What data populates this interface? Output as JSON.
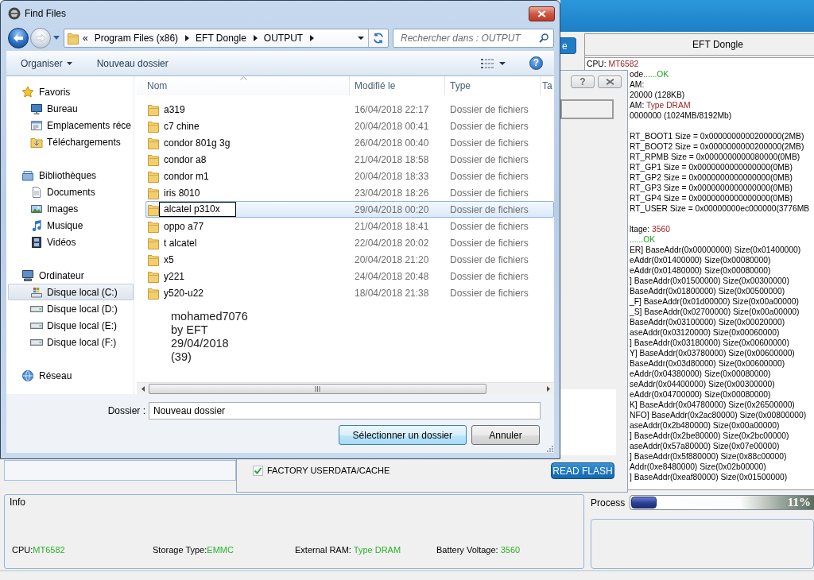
{
  "find_files_dialog": {
    "title": "Find Files",
    "address_bar": {
      "overflow": "«",
      "crumbs": [
        "Program Files (x86)",
        "EFT Dongle",
        "OUTPUT"
      ]
    },
    "search": {
      "placeholder": "Rechercher dans : OUTPUT"
    },
    "toolbar": {
      "organise": "Organiser",
      "new_folder": "Nouveau dossier",
      "help": "?"
    },
    "navigation": [
      {
        "label": "Favoris",
        "selected": false,
        "children": [
          {
            "label": "Bureau",
            "selected": false
          },
          {
            "label": "Emplacements réce",
            "selected": false
          },
          {
            "label": "Téléchargements",
            "selected": false
          }
        ]
      },
      {
        "label": "Bibliothèques",
        "selected": false,
        "children": [
          {
            "label": "Documents",
            "selected": false
          },
          {
            "label": "Images",
            "selected": false
          },
          {
            "label": "Musique",
            "selected": false
          },
          {
            "label": "Vidéos",
            "selected": false
          }
        ]
      },
      {
        "label": "Ordinateur",
        "selected": false,
        "children": [
          {
            "label": "Disque local (C:)",
            "selected": true
          },
          {
            "label": "Disque local (D:)",
            "selected": false
          },
          {
            "label": "Disque local (E:)",
            "selected": false
          },
          {
            "label": "Disque local (F:)",
            "selected": false
          }
        ]
      },
      {
        "label": "Réseau",
        "selected": false
      }
    ],
    "list": {
      "columns": [
        {
          "label": "Nom",
          "sorted": true
        },
        {
          "label": "Modifié le",
          "sorted": false
        },
        {
          "label": "Type",
          "sorted": false
        },
        {
          "label": "Ta",
          "sorted": false
        }
      ],
      "rows": [
        {
          "name": "a319",
          "modified": "16/04/2018 22:17",
          "type": "Dossier de fichiers",
          "selected": false,
          "editing": false
        },
        {
          "name": "c7 chine",
          "modified": "20/04/2018 00:41",
          "type": "Dossier de fichiers",
          "selected": false,
          "editing": false
        },
        {
          "name": "condor 801g 3g",
          "modified": "26/04/2018 00:40",
          "type": "Dossier de fichiers",
          "selected": false,
          "editing": false
        },
        {
          "name": "condor a8",
          "modified": "21/04/2018 18:58",
          "type": "Dossier de fichiers",
          "selected": false,
          "editing": false
        },
        {
          "name": "condor m1",
          "modified": "20/04/2018 18:33",
          "type": "Dossier de fichiers",
          "selected": false,
          "editing": false
        },
        {
          "name": "iris 8010",
          "modified": "23/04/2018 18:26",
          "type": "Dossier de fichiers",
          "selected": false,
          "editing": false
        },
        {
          "name": "alcatel p310x",
          "modified": "29/04/2018 00:20",
          "type": "Dossier de fichiers",
          "selected": true,
          "editing": true
        },
        {
          "name": "oppo a77",
          "modified": "21/04/2018 18:41",
          "type": "Dossier de fichiers",
          "selected": false,
          "editing": false
        },
        {
          "name": "t alcatel",
          "modified": "22/04/2018 20:02",
          "type": "Dossier de fichiers",
          "selected": false,
          "editing": false
        },
        {
          "name": "x5",
          "modified": "20/04/2018 21:20",
          "type": "Dossier de fichiers",
          "selected": false,
          "editing": false
        },
        {
          "name": "y221",
          "modified": "24/04/2018 20:48",
          "type": "Dossier de fichiers",
          "selected": false,
          "editing": false
        },
        {
          "name": "y520-u22",
          "modified": "18/04/2018 21:38",
          "type": "Dossier de fichiers",
          "selected": false,
          "editing": false
        }
      ]
    },
    "signature": [
      "mohamed7076",
      "by EFT",
      "29/04/2018",
      "(39)"
    ],
    "folder_field": {
      "label": "Dossier :",
      "value": "Nouveau dossier"
    },
    "buttons": [
      {
        "label": "Sélectionner un dossier",
        "default": true
      },
      {
        "label": "Annuler",
        "default": false
      }
    ]
  },
  "flash_dialog": {
    "help": "?",
    "options": [
      {
        "label": "FACTORY USERDATA/CACHE",
        "checked": true
      }
    ],
    "read_button": "READ FLASH"
  },
  "app_window": {
    "top_button": {
      "label": "e"
    },
    "log_panel": {
      "title": "EFT Dongle",
      "blocks": [
        [
          {
            "text": "CPU: ",
            "value": "MT6582",
            "kind": "value"
          },
          {
            "text": "ode",
            "value": "......OK",
            "kind": "status"
          },
          {
            "text": "AM:"
          },
          {
            "text": "20000 (128KB)"
          },
          {
            "text": "AM: ",
            "value": "Type DRAM",
            "kind": "value"
          },
          {
            "text": "0000000 (1024MB/8192Mb)"
          }
        ],
        [
          {
            "text": "RT_BOOT1 Size = 0x0000000000200000(2MB)"
          },
          {
            "text": "RT_BOOT2 Size = 0x0000000000200000(2MB)"
          },
          {
            "text": "RT_RPMB Size = 0x0000000000080000(0MB)"
          },
          {
            "text": "RT_GP1 Size = 0x0000000000000000(0MB)"
          },
          {
            "text": "RT_GP2 Size = 0x0000000000000000(0MB)"
          },
          {
            "text": "RT_GP3 Size = 0x0000000000000000(0MB)"
          },
          {
            "text": "RT_GP4 Size = 0x0000000000000000(0MB)"
          },
          {
            "text": "RT_USER Size = 0x00000000ec000000(3776MB"
          }
        ],
        [
          {
            "text": "ltage: ",
            "value": "3560",
            "kind": "value"
          },
          {
            "value": "......OK",
            "kind": "status"
          },
          {
            "text": "ER] BaseAddr(0x00000000) Size(0x01400000)"
          },
          {
            "text": "eAddr(0x01400000) Size(0x00080000)"
          },
          {
            "text": "eAddr(0x01480000) Size(0x00080000)"
          },
          {
            "text": "] BaseAddr(0x01500000) Size(0x00300000)"
          },
          {
            "text": "BaseAddr(0x01800000) Size(0x00500000)"
          },
          {
            "text": "_F] BaseAddr(0x01d00000) Size(0x00a00000)"
          },
          {
            "text": "_S] BaseAddr(0x02700000) Size(0x00a00000)"
          },
          {
            "text": "BaseAddr(0x03100000) Size(0x00020000)"
          },
          {
            "text": "aseAddr(0x03120000) Size(0x00060000)"
          },
          {
            "text": "] BaseAddr(0x03180000) Size(0x00600000)"
          },
          {
            "text": "Y] BaseAddr(0x03780000) Size(0x00600000)"
          },
          {
            "text": "BaseAddr(0x03d80000) Size(0x00600000)"
          },
          {
            "text": "eAddr(0x04380000) Size(0x00080000)"
          },
          {
            "text": "seAddr(0x04400000) Size(0x00300000)"
          },
          {
            "text": "eAddr(0x04700000) Size(0x00080000)"
          },
          {
            "text": "K] BaseAddr(0x04780000) Size(0x26500000)"
          },
          {
            "text": "NFO] BaseAddr(0x2ac80000) Size(0x00800000)"
          },
          {
            "text": "aseAddr(0x2b480000) Size(0x00a00000)"
          },
          {
            "text": "] BaseAddr(0x2be80000) Size(0x2bc00000)"
          },
          {
            "text": "aseAddr(0x57a80000) Size(0x07e00000)"
          },
          {
            "text": "] BaseAddr(0x5f880000) Size(0x88c00000)"
          },
          {
            "text": "Addr(0xe8480000) Size(0x02b00000)"
          },
          {
            "text": "] BaseAddr(0xeaf80000) Size(0x01500000)"
          }
        ]
      ]
    },
    "info": {
      "title": "Info",
      "items": [
        {
          "label": "CPU:",
          "value": "MT6582"
        },
        {
          "label": "Storage Type:",
          "value": "EMMC"
        },
        {
          "label": "External RAM: ",
          "value": "Type DRAM"
        },
        {
          "label": "Battery Voltage: ",
          "value": "3560"
        }
      ]
    },
    "process": {
      "label": "Process",
      "level": 0.14,
      "reading": "11%"
    }
  }
}
